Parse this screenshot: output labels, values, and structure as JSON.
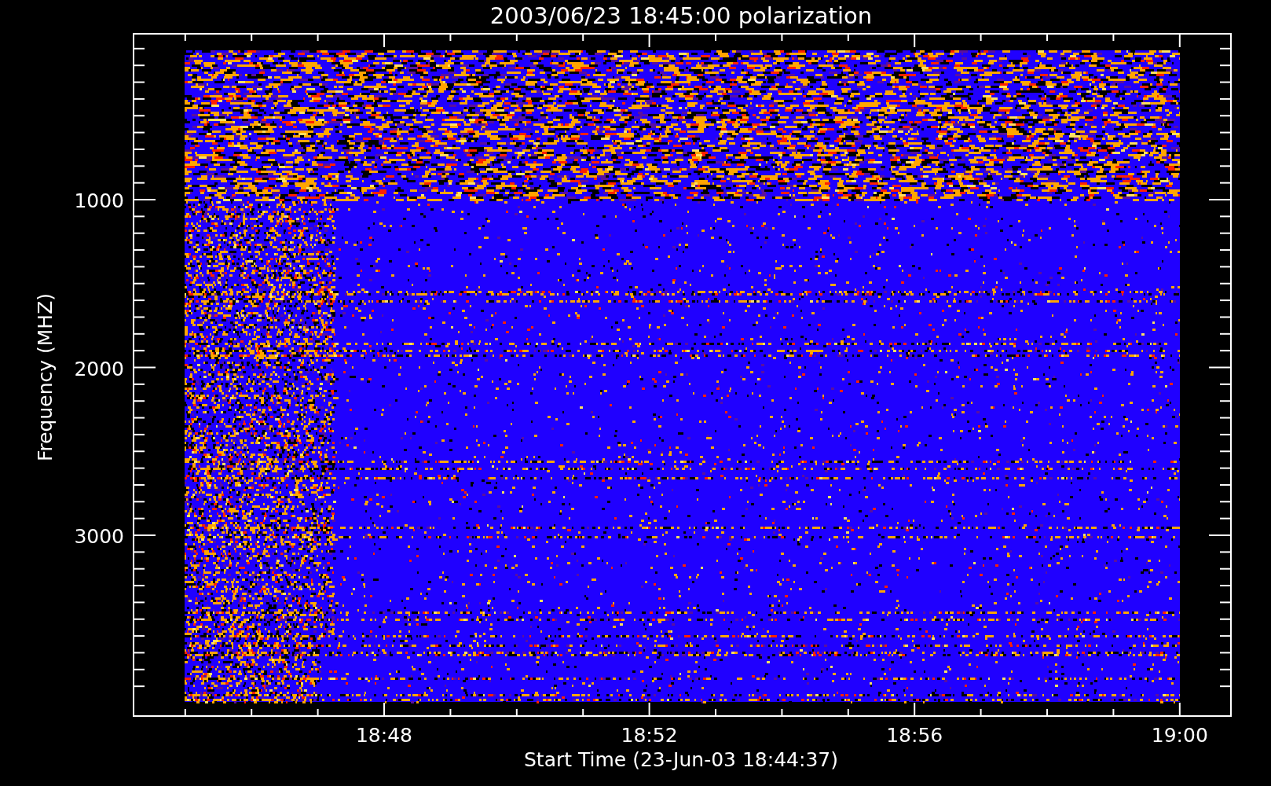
{
  "title": "2003/06/23 18:45:00 polarization",
  "y_axis": {
    "label": "Frequency (MHZ)",
    "ticks": [
      "1000",
      "2000",
      "3000"
    ]
  },
  "x_axis": {
    "label": "Start Time (23-Jun-03 18:44:37)",
    "ticks": [
      "18:48",
      "18:52",
      "18:56",
      "19:00"
    ]
  }
}
